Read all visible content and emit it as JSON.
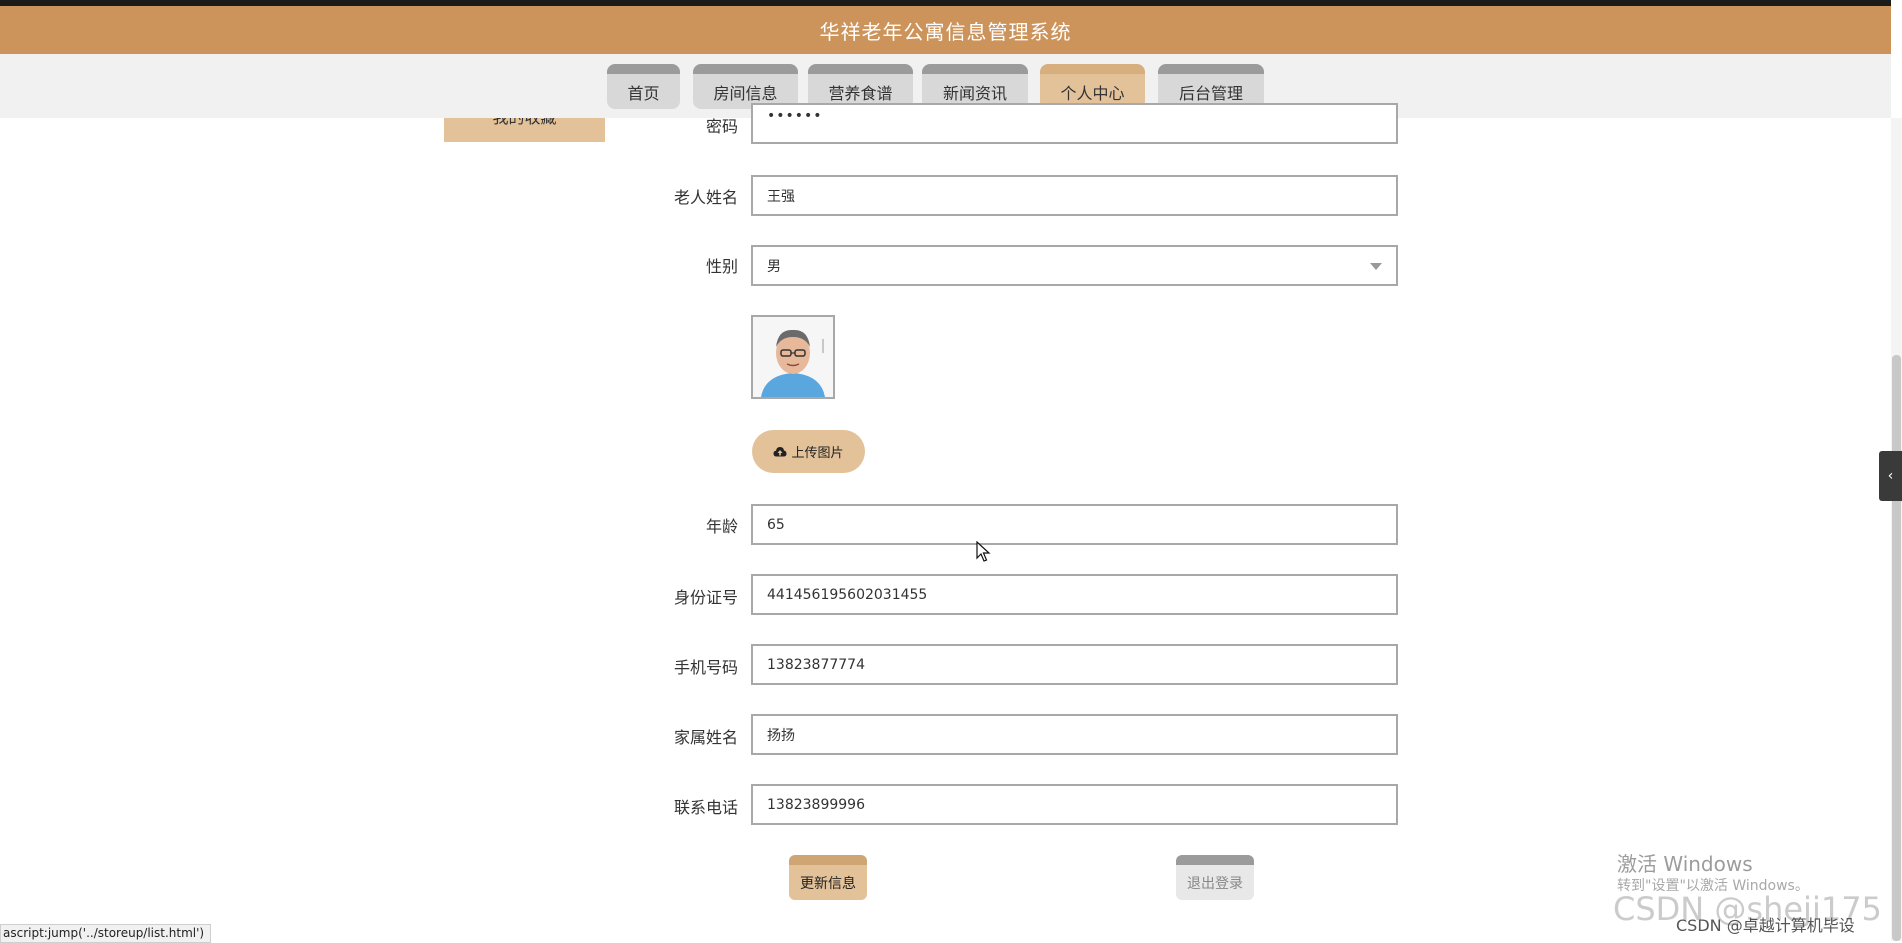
{
  "app": {
    "title": "华祥老年公寓信息管理系统"
  },
  "nav": {
    "items": [
      {
        "label": "首页"
      },
      {
        "label": "房间信息"
      },
      {
        "label": "营养食谱"
      },
      {
        "label": "新闻资讯"
      },
      {
        "label": "个人中心",
        "active": true
      },
      {
        "label": "后台管理"
      }
    ]
  },
  "sidebar": {
    "item_label": "我的收藏"
  },
  "form": {
    "password": {
      "label": "密码",
      "value": "••••••"
    },
    "name": {
      "label": "老人姓名",
      "value": "王强"
    },
    "gender": {
      "label": "性别",
      "value": "男"
    },
    "photo": {
      "icon": "avatar-photo"
    },
    "upload_label": "上传图片",
    "age": {
      "label": "年龄",
      "value": "65"
    },
    "id_number": {
      "label": "身份证号",
      "value": "441456195602031455"
    },
    "phone": {
      "label": "手机号码",
      "value": "13823877774"
    },
    "family_name": {
      "label": "家属姓名",
      "value": "扬扬"
    },
    "contact_phone": {
      "label": "联系电话",
      "value": "13823899996"
    },
    "update_label": "更新信息",
    "logout_label": "退出登录"
  },
  "status_bar": {
    "url": "ascript:jump('../storeup/list.html')"
  },
  "watermarks": {
    "windows_line1": "激活 Windows",
    "windows_line2": "转到\"设置\"以激活 Windows。",
    "csdn_big": "CSDN @sheji175",
    "csdn_small": "CSDN @卓越计算机毕设"
  },
  "colors": {
    "brand": "#cc935b",
    "accent": "#e3c29a",
    "nav_bg": "#f1f1f1"
  }
}
